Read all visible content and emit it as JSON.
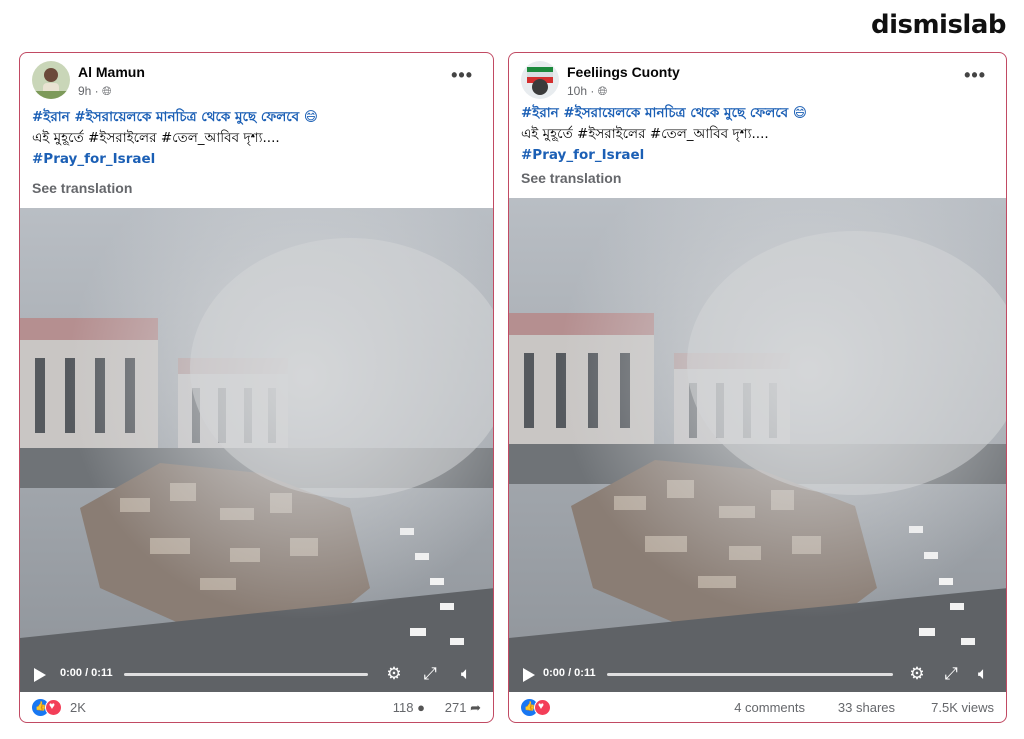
{
  "brand": "dismislab",
  "posts": [
    {
      "author": "Al Mamun",
      "time": "9h · ",
      "line1": "#ইরান #ইসরায়েলকে মানচিত্র থেকে মুছে ফেলবে 😄",
      "line2": "এই মুহূর্তে #ইসরাইলের #তেল_আবিব দৃশ্য....",
      "line3": "#Pray_for_Israel",
      "see_translation": "See translation",
      "video_time": "0:00 / 0:11",
      "reactions": "2K",
      "comments": "118",
      "shares": "271"
    },
    {
      "author": "Feeliings Cuonty",
      "time": "10h · ",
      "line1": "#ইরান #ইসরায়েলকে মানচিত্র থেকে মুছে ফেলবে 😄",
      "line2": "এই মুহূর্তে #ইসরাইলের #তেল_আবিব দৃশ্য....",
      "line3": "#Pray_for_Israel",
      "see_translation": "See translation",
      "video_time": "0:00 / 0:11",
      "comments": "4 comments",
      "shares": "33 shares",
      "views": "7.5K views"
    }
  ],
  "icons": [
    "more-icon",
    "globe-icon",
    "play-icon",
    "settings-icon",
    "fullscreen-icon",
    "volume-icon",
    "comment-icon",
    "share-icon",
    "like-icon",
    "love-icon"
  ]
}
